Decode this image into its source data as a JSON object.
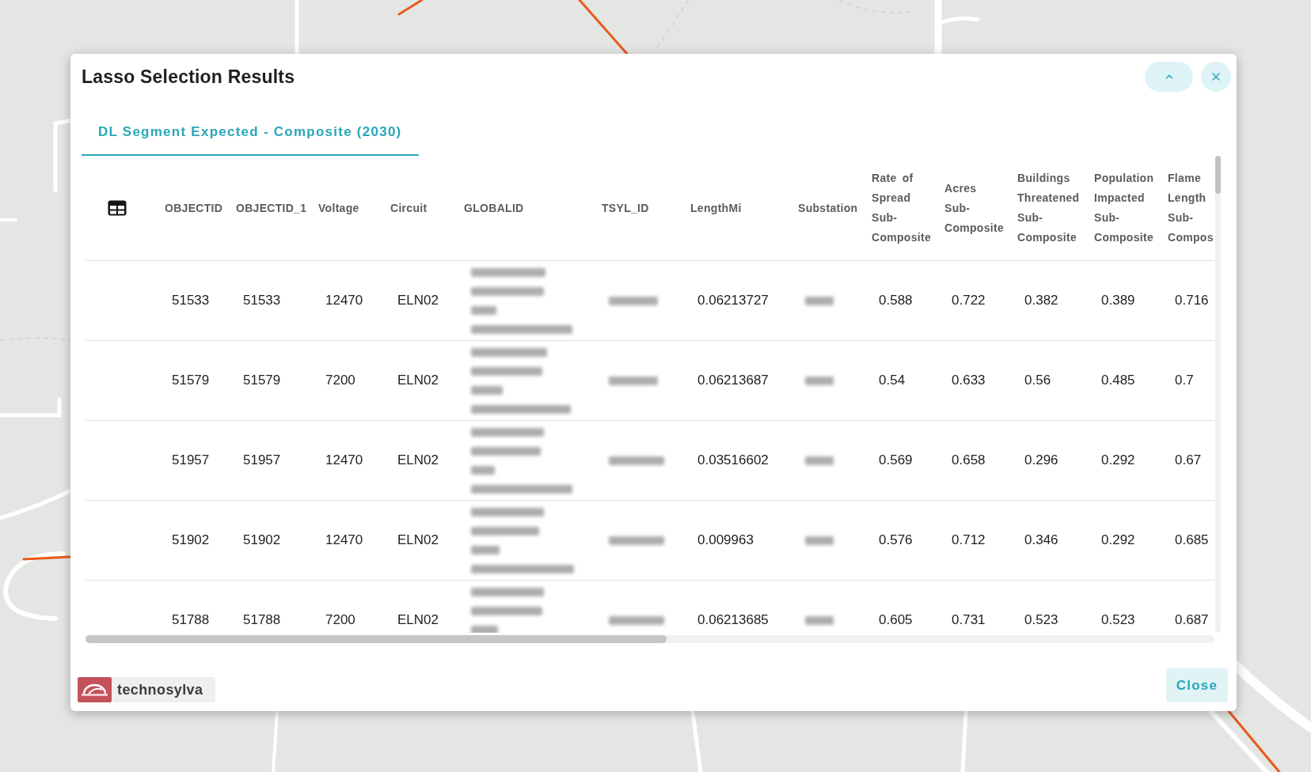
{
  "window": {
    "title": "Lasso Selection Results"
  },
  "tabs": [
    {
      "label": "DL Segment Expected - Composite (2030)",
      "selected": true
    }
  ],
  "table": {
    "columns": [
      {
        "label": "OBJECTID",
        "kind": "text"
      },
      {
        "label": "OBJECTID_1",
        "kind": "text"
      },
      {
        "label": "Voltage",
        "kind": "text"
      },
      {
        "label": "Circuit",
        "kind": "text"
      },
      {
        "label": "GLOBALID",
        "kind": "maskedwrap"
      },
      {
        "label": "TSYL_ID",
        "kind": "masked"
      },
      {
        "label": "LengthMi",
        "kind": "text"
      },
      {
        "label": "Substation",
        "kind": "masked"
      },
      {
        "label": "Rate of Spread Sub-Composite",
        "kind": "text"
      },
      {
        "label": "Acres Sub-Composite",
        "kind": "text"
      },
      {
        "label": "Buildings Threatened Sub-Composite",
        "kind": "text"
      },
      {
        "label": "Population Impacted Sub-Composite",
        "kind": "text"
      },
      {
        "label": "Flame Length Sub-Compos",
        "kind": "text"
      }
    ],
    "rows": [
      {
        "cells": [
          "51533",
          "51533",
          "12470",
          "ELN02",
          "",
          "",
          "0.06213727",
          "",
          "0.588",
          "0.722",
          "0.382",
          "0.389",
          "0.716"
        ]
      },
      {
        "cells": [
          "51579",
          "51579",
          "7200",
          "ELN02",
          "",
          "",
          "0.06213687",
          "",
          "0.54",
          "0.633",
          "0.56",
          "0.485",
          "0.7"
        ]
      },
      {
        "cells": [
          "51957",
          "51957",
          "12470",
          "ELN02",
          "",
          "",
          "0.03516602",
          "",
          "0.569",
          "0.658",
          "0.296",
          "0.292",
          "0.67"
        ]
      },
      {
        "cells": [
          "51902",
          "51902",
          "12470",
          "ELN02",
          "",
          "",
          "0.009963",
          "",
          "0.576",
          "0.712",
          "0.346",
          "0.292",
          "0.685"
        ]
      },
      {
        "cells": [
          "51788",
          "51788",
          "7200",
          "ELN02",
          "",
          "",
          "0.06213685",
          "",
          "0.605",
          "0.731",
          "0.523",
          "0.523",
          "0.687"
        ]
      }
    ]
  },
  "footer": {
    "logo_text": "technosylva",
    "close_label": "Close"
  }
}
